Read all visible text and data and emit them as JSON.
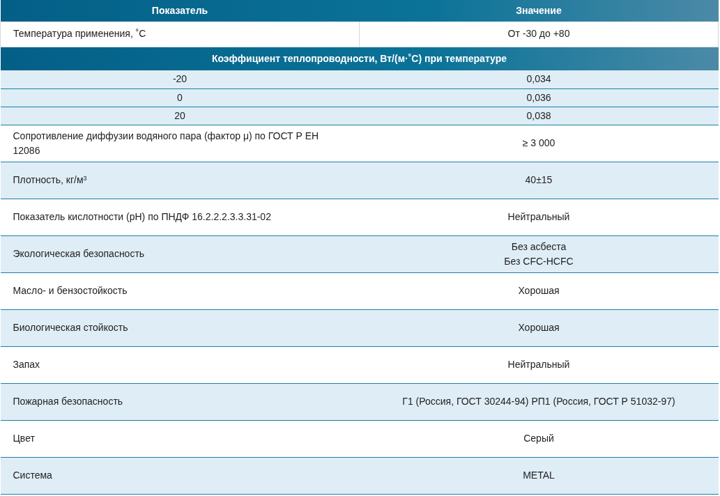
{
  "table": {
    "columns": [
      "Показатель",
      "Значение"
    ],
    "rows": [
      {
        "kind": "param",
        "name": "Температура применения, ˚С",
        "value": "От -30 до +80"
      },
      {
        "kind": "section",
        "title": "Коэффициент теплопроводности, Вт/(м·˚С) при температуре"
      },
      {
        "kind": "sub",
        "name": "-20",
        "value": "0,034"
      },
      {
        "kind": "sub",
        "name": "0",
        "value": "0,036"
      },
      {
        "kind": "sub",
        "name": "20",
        "value": "0,038"
      },
      {
        "kind": "tall",
        "name": "Сопротивление диффузии водяного пара (фактор μ) по ГОСТ Р ЕН 12086",
        "value": "≥ 3 000"
      },
      {
        "kind": "tall",
        "name": "Плотность, кг/м$^{3}$",
        "value": "40±15"
      },
      {
        "kind": "tall",
        "name": "Показатель кислотности (рН) по ПНДФ 16.2.2.2.3.3.31-02",
        "value": "Нейтральный"
      },
      {
        "kind": "tall",
        "name": "Экологическая безопасность",
        "value_lines": [
          "Без асбеста",
          "Без CFC-HCFC"
        ]
      },
      {
        "kind": "tall",
        "name": "Масло- и бензостойкость",
        "value": "Хорошая"
      },
      {
        "kind": "tall",
        "name": "Биологическая стойкость",
        "value": "Хорошая"
      },
      {
        "kind": "tall",
        "name": "Запах",
        "value": "Нейтральный"
      },
      {
        "kind": "tall",
        "name": "Пожарная безопасность",
        "value": "Г1 (Россия, ГОСТ 30244-94) РП1 (Россия, ГОСТ Р 51032-97)"
      },
      {
        "kind": "tall",
        "name": "Цвет",
        "value": "Серый"
      },
      {
        "kind": "tall",
        "name": "Система",
        "value": "METAL"
      }
    ]
  }
}
